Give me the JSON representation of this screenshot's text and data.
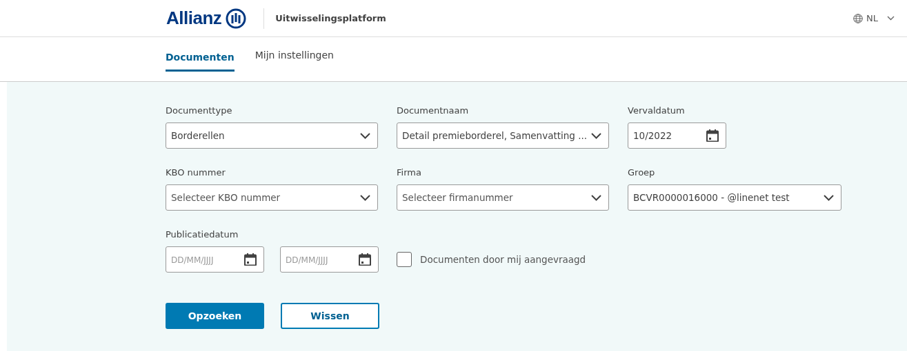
{
  "header": {
    "logo": "Allianz",
    "title": "Uitwisselingsplatform",
    "language": "NL"
  },
  "tabs": [
    {
      "label": "Documenten",
      "selected": true
    },
    {
      "label": "Mijn instellingen",
      "selected": false
    }
  ],
  "filters": [
    {
      "fields": [
        {
          "kind": "select",
          "label": "Documenttype",
          "value": "Borderellen"
        },
        {
          "kind": "select",
          "label": "Documentnaam",
          "value": "Detail premieborderel, Samenvatting ..."
        },
        {
          "kind": "date",
          "label": "Vervaldatum",
          "value": "10/2022"
        }
      ]
    },
    {
      "fields": [
        {
          "kind": "select",
          "label": "KBO nummer",
          "placeholder": "Selecteer KBO nummer"
        },
        {
          "kind": "select",
          "label": "Firma",
          "placeholder": "Selecteer firmanummer"
        },
        {
          "kind": "select",
          "label": "Groep",
          "value": "BCVR0000016000 - @linenet test"
        }
      ]
    },
    {
      "fields": [
        {
          "kind": "daterange",
          "label": "Publicatiedatum",
          "from": {
            "placeholder": "DD/MM/JJJJ"
          },
          "to": {
            "placeholder": "DD/MM/JJJJ"
          }
        },
        {
          "kind": "checkbox",
          "label": "Documenten door mij aangevraagd",
          "checked": false
        }
      ]
    }
  ],
  "buttons": [
    {
      "kind": "primary",
      "label": "Opzoeken"
    },
    {
      "kind": "secondary",
      "label": "Wissen"
    }
  ]
}
